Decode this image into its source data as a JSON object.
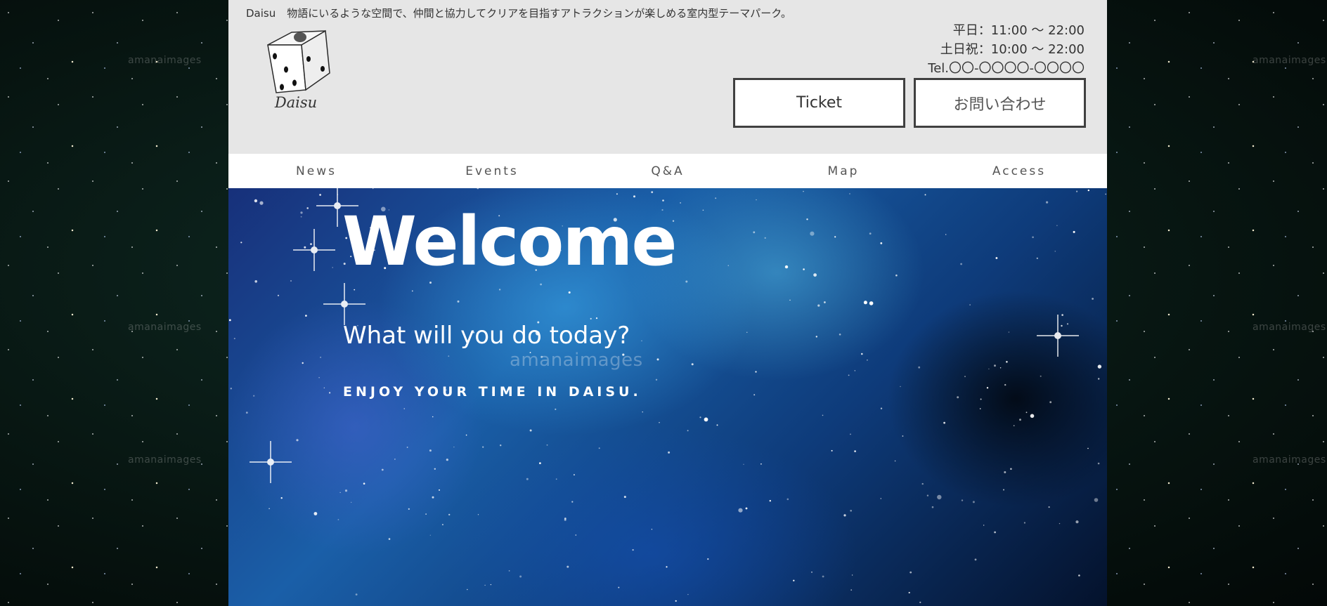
{
  "header": {
    "site_name": "Daisu",
    "tagline": "物語にいるような空間で、仲間と協力してクリアを目指すアトラクションが楽しめる室内型テーマパーク。",
    "logo_text": "Daisu",
    "hours": {
      "weekday": "平日：11:00 ～ 22:00",
      "weekend": "土日祝：10:00 ～ 22:00",
      "tel": "Tel.〇〇-〇〇〇〇-〇〇〇〇"
    },
    "buttons": {
      "ticket": "Ticket",
      "contact": "お問い合わせ"
    }
  },
  "nav": {
    "items": [
      {
        "label": "News"
      },
      {
        "label": "Events"
      },
      {
        "label": "Q&A"
      },
      {
        "label": "Map"
      },
      {
        "label": "Access"
      }
    ]
  },
  "hero": {
    "title": "Welcome",
    "subtitle": "What will you do today?",
    "tagline": "ENJOY YOUR TIME IN DAISU."
  },
  "watermark": {
    "text": "amanaimages"
  },
  "colors": {
    "header_bg": "#e6e6e6",
    "nav_bg": "#ffffff",
    "button_border": "#404040",
    "text_dark": "#333333",
    "hero_text": "#ffffff",
    "page_bg": "#061a14"
  }
}
